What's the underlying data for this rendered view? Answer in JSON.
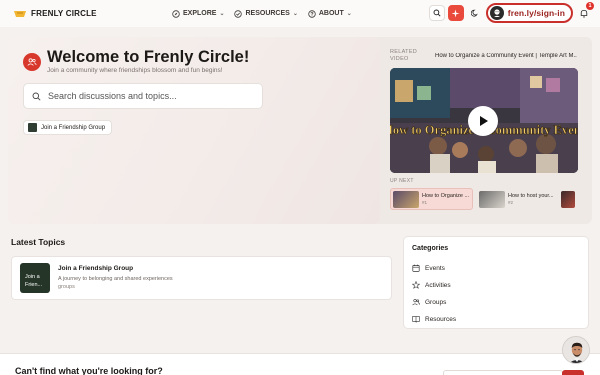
{
  "nav": {
    "brand": "FRENLY CIRCLE",
    "menu": [
      {
        "label": "EXPLORE"
      },
      {
        "label": "RESOURCES"
      },
      {
        "label": "ABOUT"
      }
    ],
    "signin_label": "fren.ly/sign-in",
    "notification_count": "1"
  },
  "hero": {
    "title": "Welcome to Frenly Circle!",
    "subtitle": "Join a community where friendships blossom and fun begins!",
    "search_placeholder": "Search discussions and topics...",
    "chip_label": "Join a Friendship Group"
  },
  "video": {
    "label": "RELATED VIDEO",
    "title": "How to Organize a Community Event | Temple Art M...",
    "overlay_text": "How to Organize a Community Event",
    "up_next_label": "UP NEXT",
    "queue": [
      {
        "title": "How to Organize ...",
        "num": "#1",
        "active": true
      },
      {
        "title": "How to host your...",
        "num": "#2",
        "active": false
      },
      {
        "title": "",
        "num": "",
        "active": false
      }
    ]
  },
  "latest": {
    "heading": "Latest Topics",
    "topics": [
      {
        "thumb_text": "Join a Frien...",
        "title": "Join a Friendship Group",
        "description": "A journey to belonging and shared experiences",
        "tag": "groups"
      }
    ]
  },
  "categories": {
    "heading": "Categories",
    "items": [
      {
        "label": "Events",
        "icon": "calendar-icon"
      },
      {
        "label": "Activities",
        "icon": "star-icon"
      },
      {
        "label": "Groups",
        "icon": "users-icon"
      },
      {
        "label": "Resources",
        "icon": "book-icon"
      }
    ]
  },
  "footer": {
    "cta": "Can't find what you're looking for?"
  },
  "colors": {
    "accent": "#e94a3c",
    "brand_red": "#c9302c",
    "background": "#f4f1ef"
  }
}
